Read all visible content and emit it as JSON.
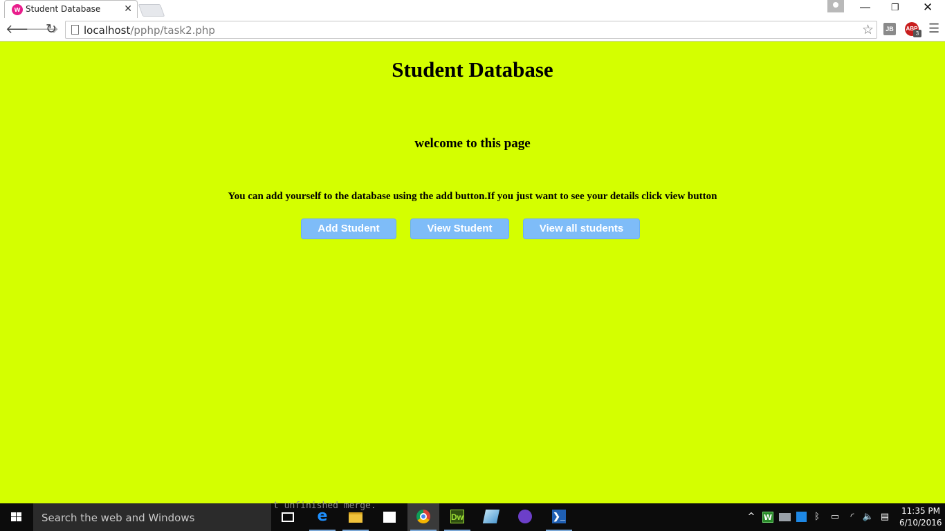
{
  "browser": {
    "tab": {
      "title": "Student Database",
      "favicon_letter": "w"
    },
    "url": {
      "host": "localhost",
      "path": "/pphp/task2.php"
    },
    "extensions": {
      "jb_label": "JB",
      "abp_label": "ABP",
      "abp_badge": "3"
    }
  },
  "page": {
    "title": "Student Database",
    "welcome": "welcome to this page",
    "description": "You can add yourself to the database using the add button.If you just want to see your details click view button",
    "buttons": {
      "add": "Add Student",
      "view": "View Student",
      "view_all": "View all students"
    },
    "background_color": "#d4ff00",
    "button_color": "#7ebcf8"
  },
  "taskbar": {
    "search_placeholder": "Search the web and Windows",
    "ghost_text": "t unfinished merge.",
    "apps": [
      "task-view",
      "edge",
      "file-explorer",
      "store",
      "chrome",
      "dreamweaver",
      "app",
      "github",
      "powershell"
    ],
    "clock": {
      "time": "11:35 PM",
      "date": "6/10/2016"
    }
  }
}
